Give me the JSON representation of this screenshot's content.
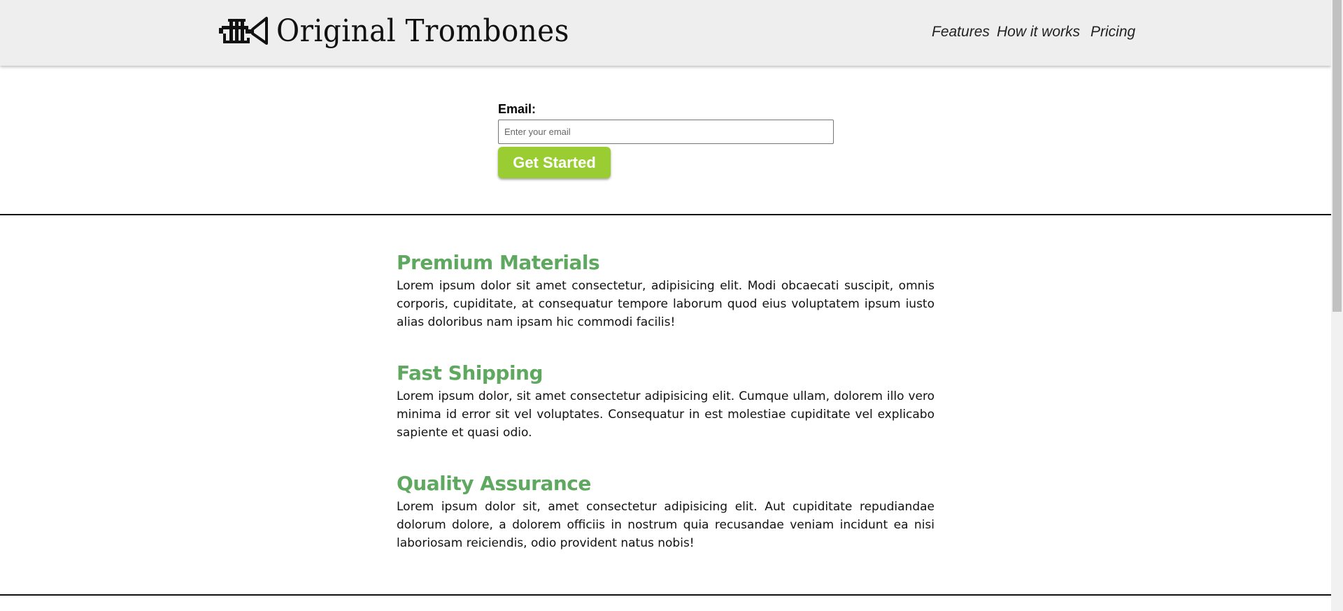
{
  "brand": {
    "name": "Original Trombones",
    "logo_icon": "trumpet-icon"
  },
  "nav": {
    "items": [
      "Features",
      "How it works",
      "Pricing"
    ]
  },
  "form": {
    "label": "Email:",
    "placeholder": "Enter your email",
    "button_label": "Get Started",
    "button_color": "#9acd32"
  },
  "features": [
    {
      "title": "Premium Materials",
      "text": "Lorem ipsum dolor sit amet consectetur, adipisicing elit. Modi obcaecati suscipit, omnis corporis, cupiditate, at consequatur tempore laborum quod eius voluptatem ipsum iusto alias doloribus nam ipsam hic commodi facilis!"
    },
    {
      "title": "Fast Shipping",
      "text": "Lorem ipsum dolor, sit amet consectetur adipisicing elit. Cumque ullam, dolorem illo vero minima id error sit vel voluptates. Consequatur in est molestiae cupiditate vel explicabo sapiente et quasi odio."
    },
    {
      "title": "Quality Assurance",
      "text": "Lorem ipsum dolor sit, amet consectetur adipisicing elit. Aut cupiditate repudiandae dolorum dolore, a dolorem officiis in nostrum quia recusandae veniam incidunt ea nisi laboriosam reiciendis, odio provident natus nobis!"
    }
  ],
  "colors": {
    "header_bg": "#eeeeee",
    "feature_title": "#5fa85f"
  }
}
